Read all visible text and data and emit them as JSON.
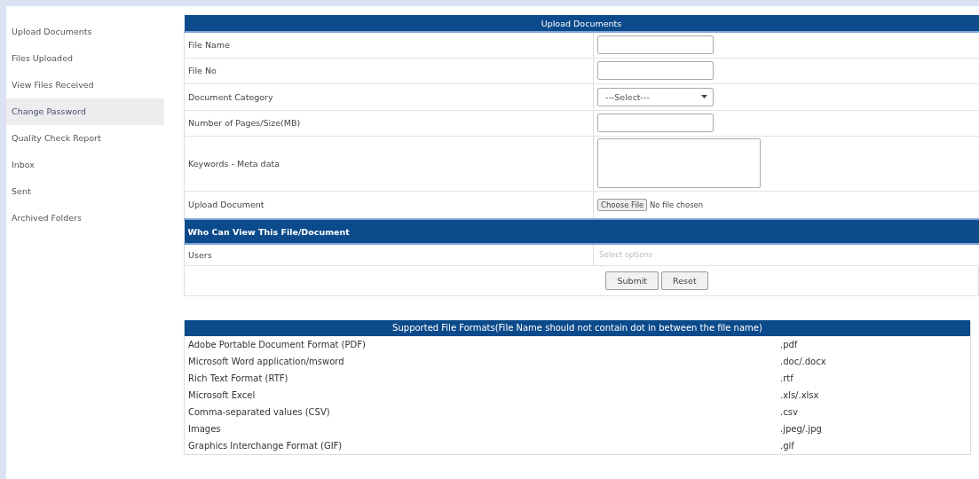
{
  "sidebar": {
    "items": [
      {
        "label": "Upload Documents",
        "selected": false
      },
      {
        "label": "Files Uploaded",
        "selected": false
      },
      {
        "label": "View Files Received",
        "selected": false
      },
      {
        "label": "Change Password",
        "selected": true
      },
      {
        "label": "Quality Check Report",
        "selected": false
      },
      {
        "label": "Inbox",
        "selected": false
      },
      {
        "label": "Sent",
        "selected": false
      },
      {
        "label": "Archived Folders",
        "selected": false
      }
    ]
  },
  "upload_form": {
    "title": "Upload Documents",
    "fields": [
      {
        "label": "File Name",
        "kind": "text"
      },
      {
        "label": "File No",
        "kind": "text"
      },
      {
        "label": "Document Category",
        "kind": "select",
        "value": "---Select---"
      },
      {
        "label": "Number of Pages/Size(MB)",
        "kind": "text"
      },
      {
        "label": "Keywords - Meta data",
        "kind": "textarea"
      },
      {
        "label": "Upload Document",
        "kind": "file",
        "button": "Choose File",
        "status": "No file chosen"
      }
    ],
    "section_title": "Who Can View This File/Document",
    "section_fields": [
      {
        "label": "Users",
        "kind": "multiselect",
        "placeholder": "Select options"
      }
    ],
    "buttons": [
      "Submit",
      "Reset"
    ]
  },
  "formats_table": {
    "title": "Supported File Formats(File Name should not contain dot in between the file name)",
    "rows": [
      {
        "format": "Adobe Portable Document Format (PDF)",
        "extension": ".pdf"
      },
      {
        "format": "Microsoft Word application/msword",
        "extension": ".doc/.docx"
      },
      {
        "format": "Rich Text Format (RTF)",
        "extension": ".rtf"
      },
      {
        "format": "Microsoft Excel",
        "extension": ".xls/.xlsx"
      },
      {
        "format": "Comma-separated values (CSV)",
        "extension": ".csv"
      },
      {
        "format": "Images",
        "extension": ".jpeg/.jpg"
      },
      {
        "format": "Graphics Interchange Format (GIF)",
        "extension": ".gif"
      }
    ]
  }
}
